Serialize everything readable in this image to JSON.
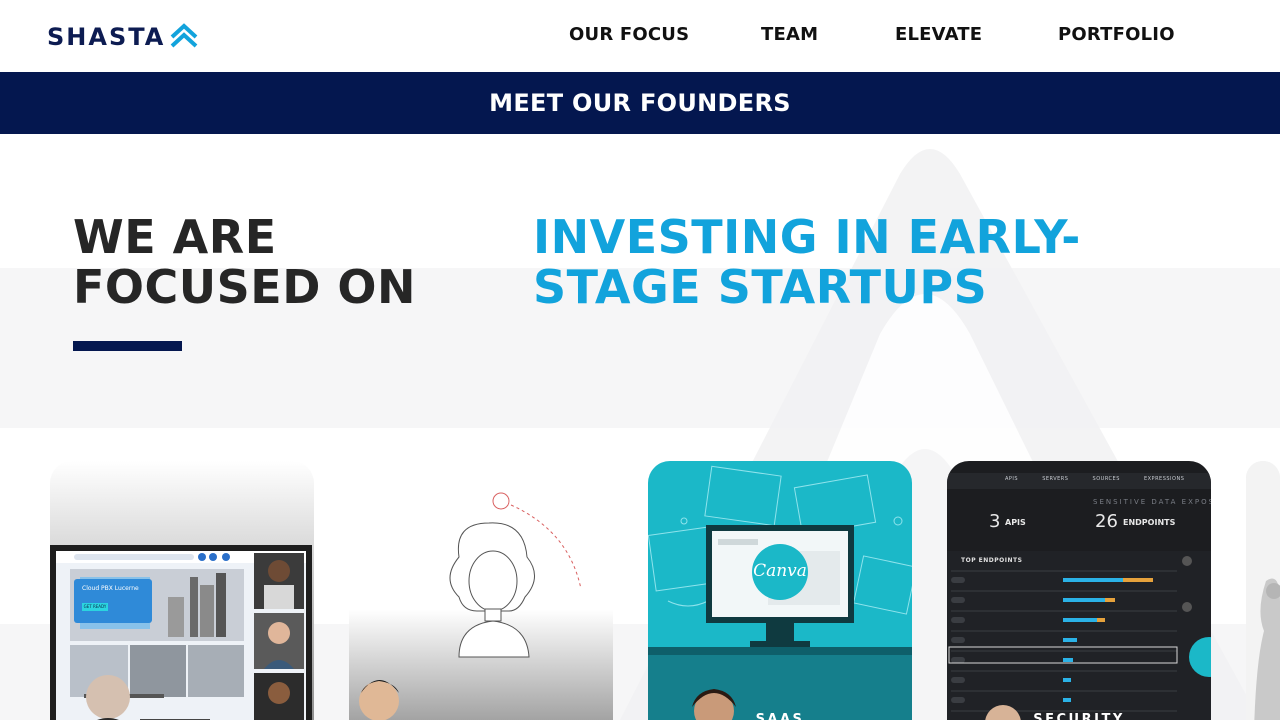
{
  "brand": {
    "name": "SHASTA"
  },
  "nav": {
    "items": [
      {
        "label": "OUR FOCUS"
      },
      {
        "label": "TEAM"
      },
      {
        "label": "ELEVATE"
      },
      {
        "label": "PORTFOLIO"
      }
    ]
  },
  "banner": {
    "label": "MEET OUR FOUNDERS"
  },
  "hero": {
    "heading_left": "WE ARE FOCUSED ON",
    "heading_right": "INVESTING IN EARLY-STAGE STARTUPS"
  },
  "cards": [
    {
      "label": "",
      "screen": {
        "title": "Cloud PBX Lucerne",
        "button": "GET READY"
      }
    },
    {
      "label": ""
    },
    {
      "label": "SAAS",
      "screen": {
        "logo": "Canva"
      }
    },
    {
      "label": "SECURITY",
      "screen": {
        "tabs": [
          "APIS",
          "SERVERS",
          "SOURCES",
          "EXPRESSIONS"
        ],
        "title": "SENSITIVE DATA EXPOSURE",
        "stat1_value": "3",
        "stat1_label": "APIS",
        "stat2_value": "26",
        "stat2_label": "ENDPOINTS",
        "list_title": "TOP ENDPOINTS"
      }
    }
  ],
  "colors": {
    "navy": "#04174f",
    "accent_blue": "#12a3dc",
    "teal": "#1bb8c8",
    "dark_text": "#262626"
  }
}
